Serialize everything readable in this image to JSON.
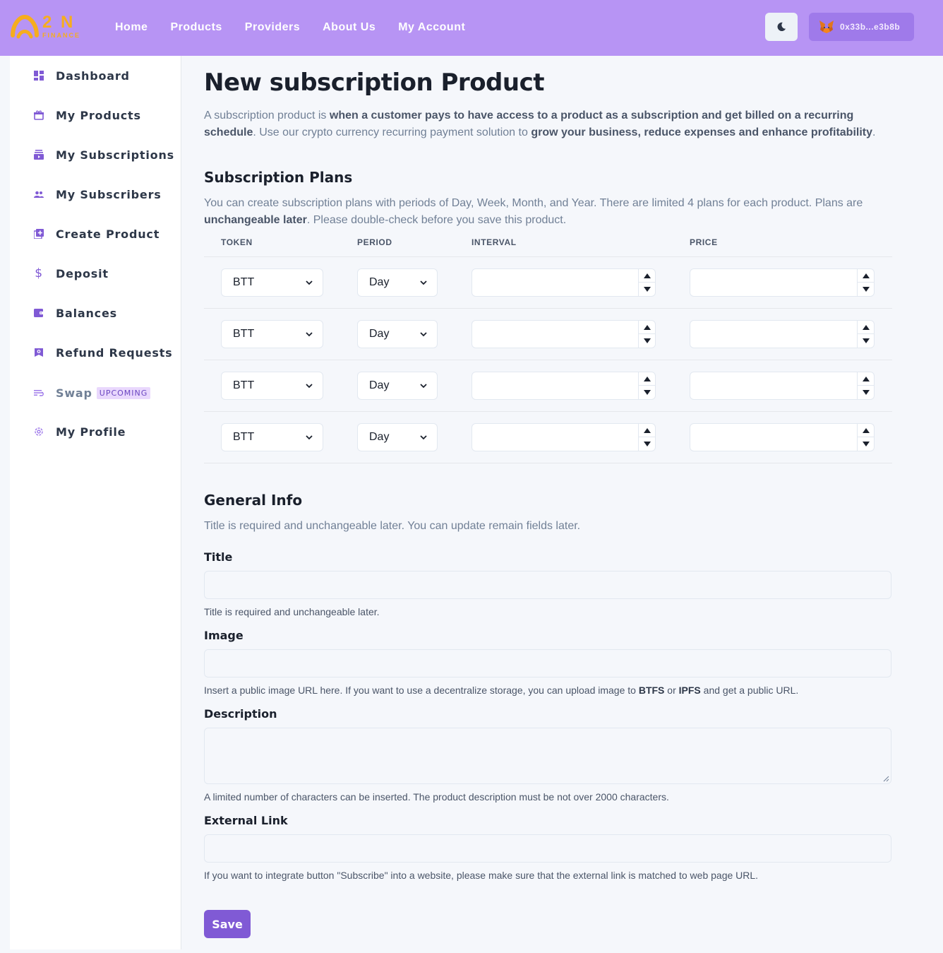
{
  "header": {
    "logo_main": "2 N",
    "logo_sub": "FINANCE",
    "nav": [
      "Home",
      "Products",
      "Providers",
      "About Us",
      "My Account"
    ],
    "wallet_address": "0x33b...e3b8b",
    "colors": {
      "header_bg": "#b794f4",
      "accent": "#805ad5",
      "logo": "#f6ad1e"
    }
  },
  "sidebar": {
    "items": [
      {
        "label": "Dashboard",
        "icon": "dashboard-icon"
      },
      {
        "label": "My Products",
        "icon": "gift-icon"
      },
      {
        "label": "My Subscriptions",
        "icon": "subscription-icon"
      },
      {
        "label": "My Subscribers",
        "icon": "users-icon"
      },
      {
        "label": "Create Product",
        "icon": "add-box-icon"
      },
      {
        "label": "Deposit",
        "icon": "dollar-icon"
      },
      {
        "label": "Balances",
        "icon": "wallet-icon"
      },
      {
        "label": "Refund Requests",
        "icon": "refund-icon"
      },
      {
        "label": "Swap",
        "icon": "swap-icon",
        "badge": "UPCOMING"
      },
      {
        "label": "My Profile",
        "icon": "gear-icon"
      }
    ]
  },
  "main": {
    "title": "New subscription Product",
    "intro": {
      "p1": "A subscription product is ",
      "b1": "when a customer pays to have access to a product as a subscription and get billed on a recurring schedule",
      "p2": ". Use our crypto currency recurring payment solution to ",
      "b2": "grow your business, reduce expenses and enhance profitability",
      "p3": "."
    },
    "plans": {
      "heading": "Subscription Plans",
      "desc_p1": "You can create subscription plans with periods of Day, Week, Month, and Year. There are limited 4 plans for each product. Plans are ",
      "desc_b1": "unchangeable later",
      "desc_p2": ". Please double-check before you save this product.",
      "columns": {
        "token": "TOKEN",
        "period": "PERIOD",
        "interval": "INTERVAL",
        "price": "PRICE"
      },
      "rows": [
        {
          "token": "BTT",
          "period": "Day",
          "interval": "",
          "price": ""
        },
        {
          "token": "BTT",
          "period": "Day",
          "interval": "",
          "price": ""
        },
        {
          "token": "BTT",
          "period": "Day",
          "interval": "",
          "price": ""
        },
        {
          "token": "BTT",
          "period": "Day",
          "interval": "",
          "price": ""
        }
      ]
    },
    "general": {
      "heading": "General Info",
      "desc": "Title is required and unchangeable later. You can update remain fields later.",
      "title_label": "Title",
      "title_value": "",
      "title_help": "Title is required and unchangeable later.",
      "image_label": "Image",
      "image_value": "",
      "image_help_p1": "Insert a public image URL here. If you want to use a decentralize storage, you can upload image to ",
      "image_help_b1": "BTFS",
      "image_help_p2": " or ",
      "image_help_b2": "IPFS",
      "image_help_p3": " and get a public URL.",
      "description_label": "Description",
      "description_value": "",
      "description_help": "A limited number of characters can be inserted. The product description must be not over 2000 characters.",
      "link_label": "External Link",
      "link_value": "",
      "link_help": "If you want to integrate button \"Subscribe\" into a website, please make sure that the external link is matched to web page URL.",
      "save_label": "Save"
    }
  }
}
